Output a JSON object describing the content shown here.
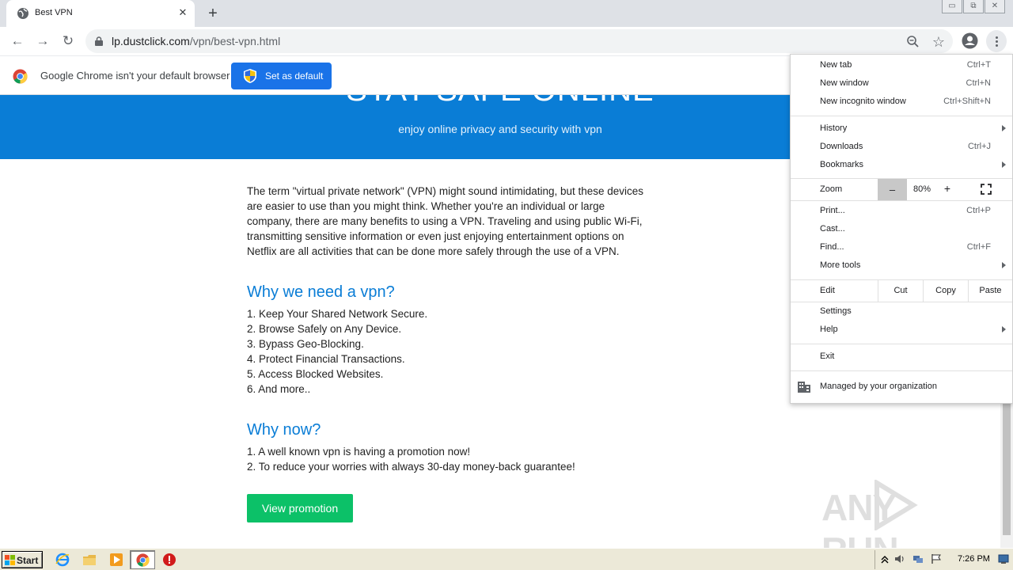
{
  "browser": {
    "tab": {
      "title": "Best VPN",
      "close": "✕"
    },
    "newtab": "+",
    "window_controls": [
      "▭",
      "⧉",
      "✕"
    ],
    "url": {
      "host": "lp.dustclick.com",
      "path": "/vpn/best-vpn.html"
    },
    "icons": {
      "back": "←",
      "forward": "→",
      "reload": "↻",
      "zoom": "zoom-icon",
      "bookmark": "☆"
    }
  },
  "infobar": {
    "message": "Google Chrome isn't your default browser",
    "button_label": "Set as default"
  },
  "page": {
    "hero_title": "STAY SAFE ONLINE",
    "hero_subtitle": "enjoy online privacy and security with vpn",
    "intro_lines": [
      "The term \"virtual private network\" (VPN) might sound intimidating, but these devices",
      "are easier to use than you might think. Whether you're an individual or large",
      "company, there are many benefits to using a VPN. Traveling and using public Wi-Fi,",
      "transmitting sensitive information or even just enjoying entertainment options on",
      "Netflix are all activities that can be done more safely through the use of a VPN."
    ],
    "section1_title": "Why we need a vpn?",
    "section1_items": [
      "1. Keep Your Shared Network Secure.",
      "2. Browse Safely on Any Device.",
      "3. Bypass Geo-Blocking.",
      "4. Protect Financial Transactions.",
      "5. Access Blocked Websites.",
      "6. And more.."
    ],
    "section2_title": "Why now?",
    "section2_items": [
      "1. A well known vpn is having a promotion now!",
      "2. To reduce your worries with always 30-day money-back guarantee!"
    ],
    "promo_button": "View promotion",
    "watermark": "ANY RUN"
  },
  "menu": {
    "new_tab": {
      "label": "New tab",
      "shortcut": "Ctrl+T"
    },
    "new_window": {
      "label": "New window",
      "shortcut": "Ctrl+N"
    },
    "new_incognito": {
      "label": "New incognito window",
      "shortcut": "Ctrl+Shift+N"
    },
    "history": {
      "label": "History"
    },
    "downloads": {
      "label": "Downloads",
      "shortcut": "Ctrl+J"
    },
    "bookmarks": {
      "label": "Bookmarks"
    },
    "zoom": {
      "label": "Zoom",
      "minus": "–",
      "value": "80%",
      "plus": "+"
    },
    "print": {
      "label": "Print...",
      "shortcut": "Ctrl+P"
    },
    "cast": {
      "label": "Cast..."
    },
    "find": {
      "label": "Find...",
      "shortcut": "Ctrl+F"
    },
    "more_tools": {
      "label": "More tools"
    },
    "edit": {
      "label": "Edit",
      "cut": "Cut",
      "copy": "Copy",
      "paste": "Paste"
    },
    "settings": {
      "label": "Settings"
    },
    "help": {
      "label": "Help"
    },
    "exit": {
      "label": "Exit"
    },
    "managed": {
      "label": "Managed by your organization"
    }
  },
  "taskbar": {
    "start": "Start",
    "clock": "7:26 PM"
  },
  "colors": {
    "hero_blue": "#0a7dd6",
    "heading_blue": "#0a7dd6",
    "promo_green": "#0cc168",
    "chrome_blue": "#1a73e8"
  }
}
